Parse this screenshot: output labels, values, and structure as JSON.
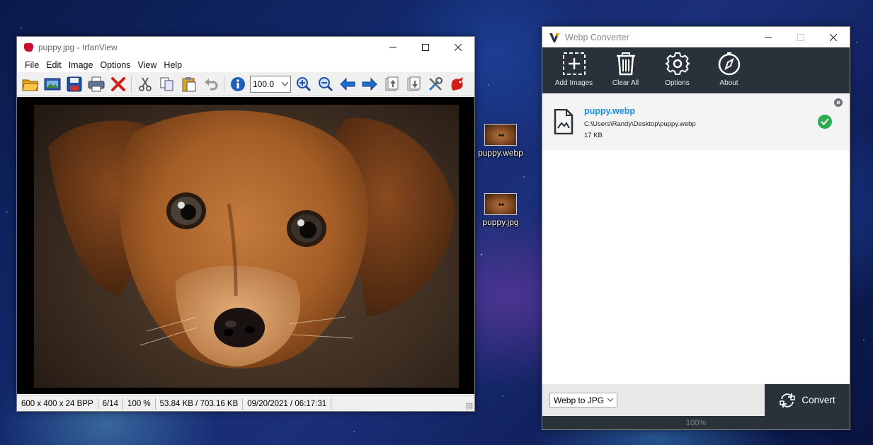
{
  "irfanview": {
    "title": "puppy.jpg - IrfanView",
    "menu": [
      "File",
      "Edit",
      "Image",
      "Options",
      "View",
      "Help"
    ],
    "toolbar": {
      "buttons": [
        "open-folder-icon",
        "slideshow-icon",
        "save-icon",
        "print-icon",
        "delete-icon",
        "cut-icon",
        "copy-icon",
        "paste-icon",
        "undo-icon",
        "info-icon",
        "zoom-in-icon",
        "zoom-out-icon",
        "previous-icon",
        "next-icon",
        "move-up-icon",
        "move-down-icon",
        "settings-tools-icon",
        "irfanview-logo-icon"
      ],
      "zoom_value": "100.0"
    },
    "status": {
      "dimensions": "600 x 400 x 24 BPP",
      "index": "6/14",
      "zoom": "100 %",
      "size": "53.84 KB / 703.16 KB",
      "datetime": "09/20/2021 / 06:17:31"
    }
  },
  "desktop": {
    "icons": [
      {
        "label": "puppy.webp"
      },
      {
        "label": "puppy.jpg"
      }
    ]
  },
  "webp_converter": {
    "title": "Webp Converter",
    "toolbar": [
      {
        "label": "Add Images",
        "icon": "add-images-icon"
      },
      {
        "label": "Clear All",
        "icon": "trash-icon"
      },
      {
        "label": "Options",
        "icon": "gear-icon"
      },
      {
        "label": "About",
        "icon": "compass-icon"
      }
    ],
    "files": [
      {
        "name": "puppy.webp",
        "path": "C:\\Users\\Randy\\Desktop\\puppy.webp",
        "size": "17 KB",
        "status": "done"
      }
    ],
    "format_select": "Webp to JPG",
    "convert_label": "Convert",
    "progress": "100%",
    "colors": {
      "dark": "#29313a",
      "accent": "#1a8fd8",
      "success": "#2eab4e"
    }
  }
}
